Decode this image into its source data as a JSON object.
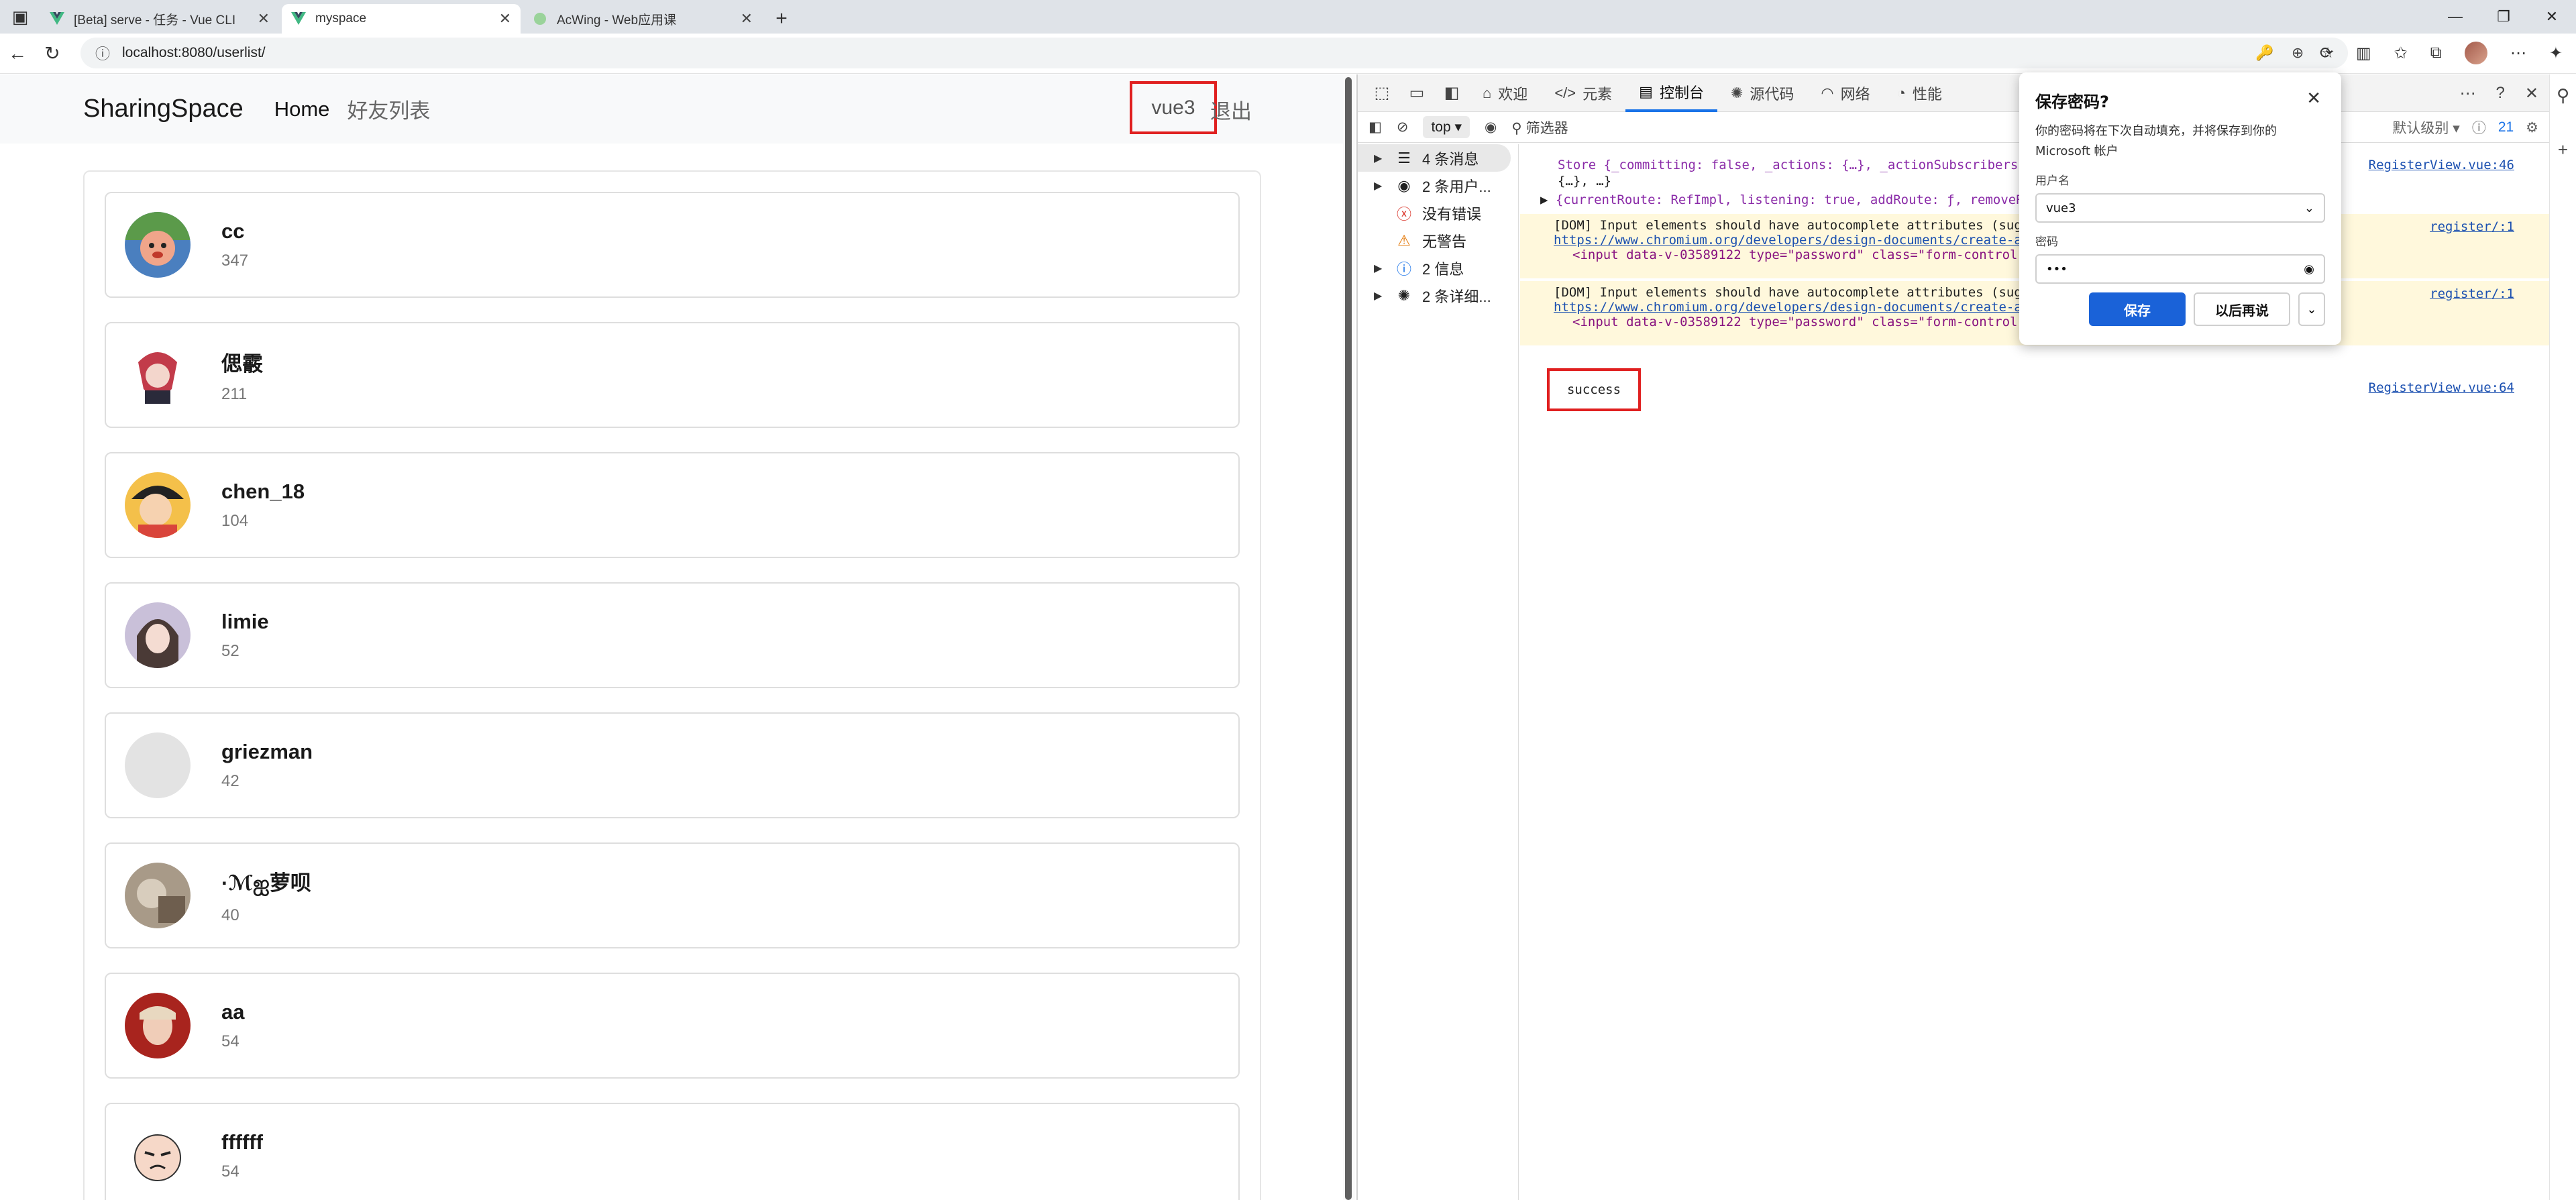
{
  "browser": {
    "tabs": [
      {
        "title": "[Beta] serve - 任务 - Vue CLI",
        "active": false
      },
      {
        "title": "myspace",
        "active": true
      },
      {
        "title": "AcWing - Web应用课",
        "active": false
      }
    ],
    "url": "localhost:8080/userlist/"
  },
  "navbar": {
    "brand": "SharingSpace",
    "home": "Home",
    "friends": "好友列表",
    "username": "vue3",
    "logout": "退出"
  },
  "users": [
    {
      "name": "cc",
      "count": "347"
    },
    {
      "name": "偲霰",
      "count": "211"
    },
    {
      "name": "chen_18",
      "count": "104"
    },
    {
      "name": "limie",
      "count": "52"
    },
    {
      "name": "griezman",
      "count": "42"
    },
    {
      "name": "·ℳஐ萝呗",
      "count": "40"
    },
    {
      "name": "aa",
      "count": "54"
    },
    {
      "name": "ffffff",
      "count": "54"
    }
  ],
  "devtools": {
    "tabs": [
      "欢迎",
      "元素",
      "控制台",
      "源代码",
      "网络",
      "性能"
    ],
    "context": "top",
    "filter_placeholder": "筛选器",
    "levels": "默认级别",
    "issue_count": "21",
    "sidebar": [
      {
        "label": "4 条消息"
      },
      {
        "label": "2 条用户..."
      },
      {
        "label": "没有错误"
      },
      {
        "label": "无警告"
      },
      {
        "label": "2 信息"
      },
      {
        "label": "2 条详细..."
      }
    ],
    "console": {
      "store_line1": "Store {_committing: false, _actions: {…}, _actionSubscribers: [], _mutations: {…}, _wrappedGetters:",
      "store_line2": "{…}, …}",
      "route_line": "{currentRoute: RefImpl, listening: true, addRoute: ƒ, removeRoute: ƒ, hasRoute: ƒ, …}",
      "src_register46": "RegisterView.vue:46",
      "warn1_text": "[DOM] Input elements should have autocomplete attributes (suggested: \"new-password\"): (More info:",
      "warn_link": "https://www.chromium.org/developers/design-documents/create-amazing-password-forms",
      "warn1_code": "<input data-v-03589122 type=\"password\" class=\"form-control\" id=\"password\">",
      "warn2_text": "[DOM] Input elements should have autocomplete attributes (suggested: \"new-password\"): (More info:",
      "warn2_code": "<input data-v-03589122 type=\"password\" class=\"form-control\" id=\"password_confirm\">",
      "src_register1": "register/:1",
      "success": "success",
      "src_register64": "RegisterView.vue:64"
    }
  },
  "password_popup": {
    "title": "保存密码?",
    "desc": "你的密码将在下次自动填充，并将保存到你的 Microsoft 帐户",
    "username_label": "用户名",
    "username_value": "vue3",
    "password_label": "密码",
    "password_value": "•••",
    "save": "保存",
    "later": "以后再说"
  }
}
